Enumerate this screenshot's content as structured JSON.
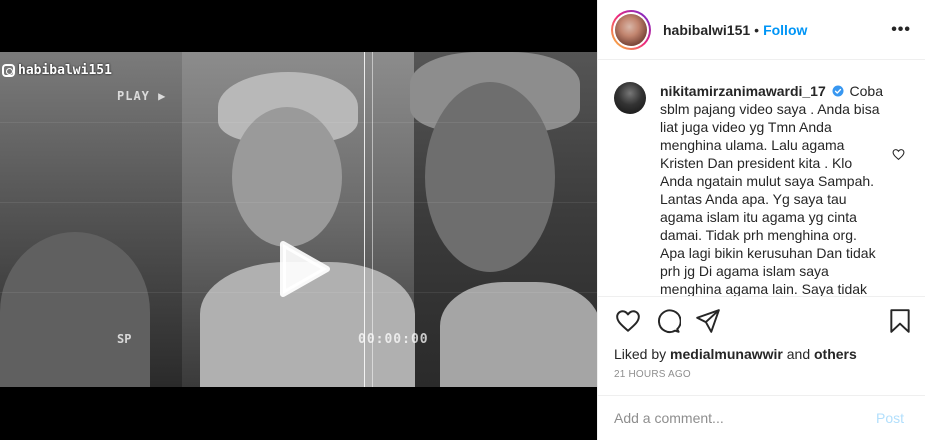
{
  "video": {
    "watermark": "habibalwi151",
    "vhs_play_label": "PLAY ▶",
    "vhs_speed": "SP",
    "vhs_time": "00:00:00",
    "play_icon": "play-icon",
    "audio_icon": "speaker-icon"
  },
  "header": {
    "username": "habibalwi151",
    "separator": "•",
    "follow_label": "Follow",
    "more_label": "•••"
  },
  "comment": {
    "username": "nikitamirzanimawardi_17",
    "text": "Coba sblm pajang video saya . Anda bisa liat juga video yg Tmn Anda menghina ulama. Lalu agama Kristen Dan president kita . Klo Anda ngatain mulut saya Sampah. Lantas Anda apa. Yg saya tau agama islam itu agama yg cinta damai. Tidak prh menghina org. Apa lagi bikin kerusuhan Dan tidak prh jg Di agama islam saya menghina agama lain. Saya tidak",
    "verified_icon": "verified-badge-icon"
  },
  "actions": {
    "icons": [
      "heart-icon",
      "comment-icon",
      "share-icon",
      "bookmark-icon"
    ],
    "liked_prefix": "Liked by",
    "liked_user": "medialmunawwir",
    "liked_and": "and",
    "liked_others": "others",
    "timestamp": "21 HOURS AGO"
  },
  "add_comment": {
    "placeholder": "Add a comment...",
    "post_label": "Post"
  },
  "colors": {
    "accent": "#0095f6",
    "post_disabled": "#b2dffc",
    "muted": "#8e8e8e",
    "text": "#262626"
  }
}
